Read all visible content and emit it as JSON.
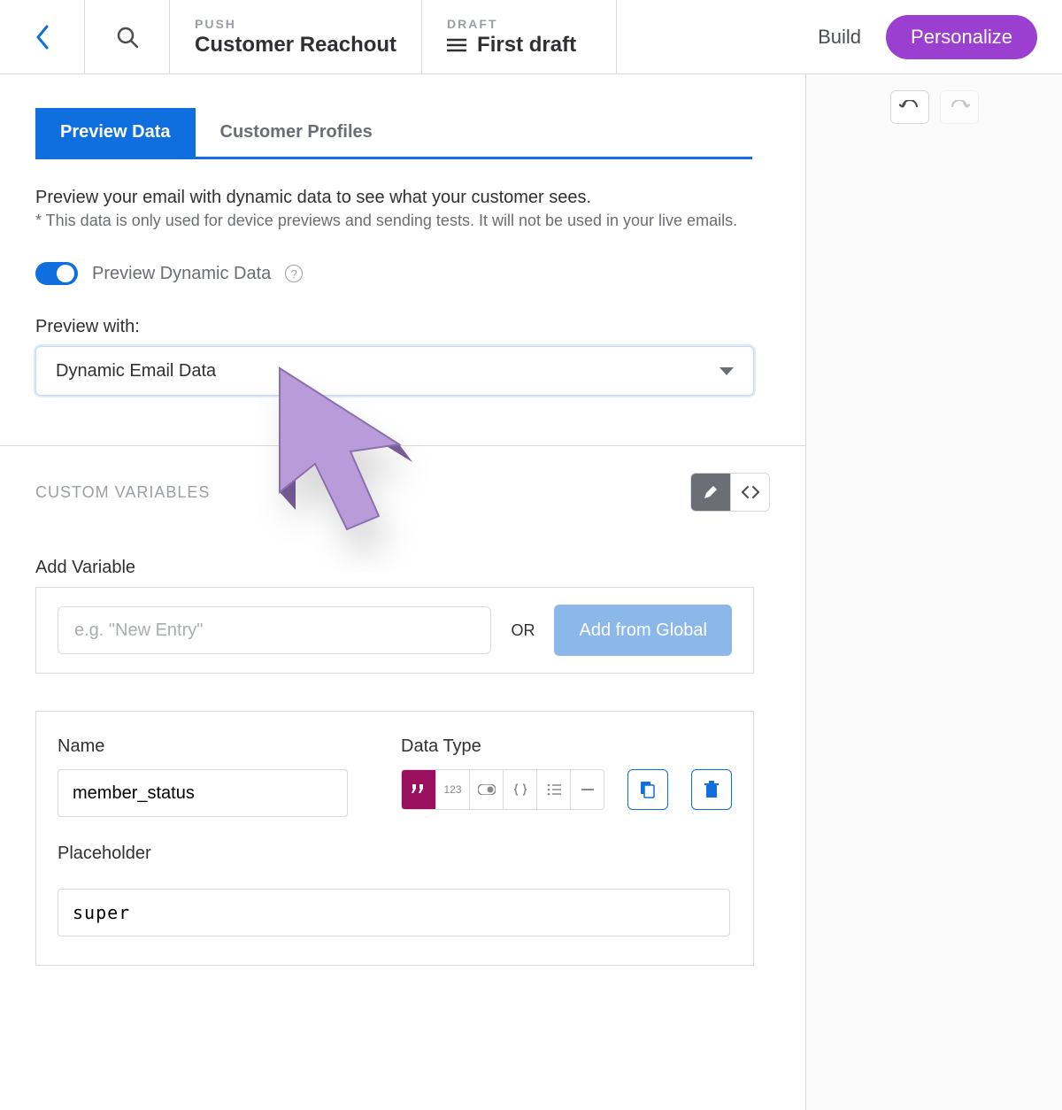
{
  "topbar": {
    "push_eyebrow": "PUSH",
    "push_title": "Customer Reachout",
    "draft_eyebrow": "DRAFT",
    "draft_title": "First draft",
    "build": "Build",
    "personalize": "Personalize"
  },
  "tabs": {
    "preview": "Preview Data",
    "profiles": "Customer Profiles"
  },
  "intro": {
    "line1": "Preview your email with dynamic data to see what your customer sees.",
    "line2": "* This data is only used for device previews and sending tests. It will not be used in your live emails."
  },
  "toggle": {
    "label": "Preview Dynamic Data"
  },
  "preview_with": {
    "label": "Preview with:",
    "selected": "Dynamic Email Data"
  },
  "custom_vars": {
    "title": "CUSTOM VARIABLES",
    "add_label": "Add Variable",
    "add_placeholder": "e.g. \"New Entry\"",
    "or": "OR",
    "add_global": "Add from Global"
  },
  "variable": {
    "name_label": "Name",
    "name_value": "member_status",
    "dtype_label": "Data Type",
    "dtype_num": "123",
    "placeholder_label": "Placeholder",
    "placeholder_value": "super"
  }
}
